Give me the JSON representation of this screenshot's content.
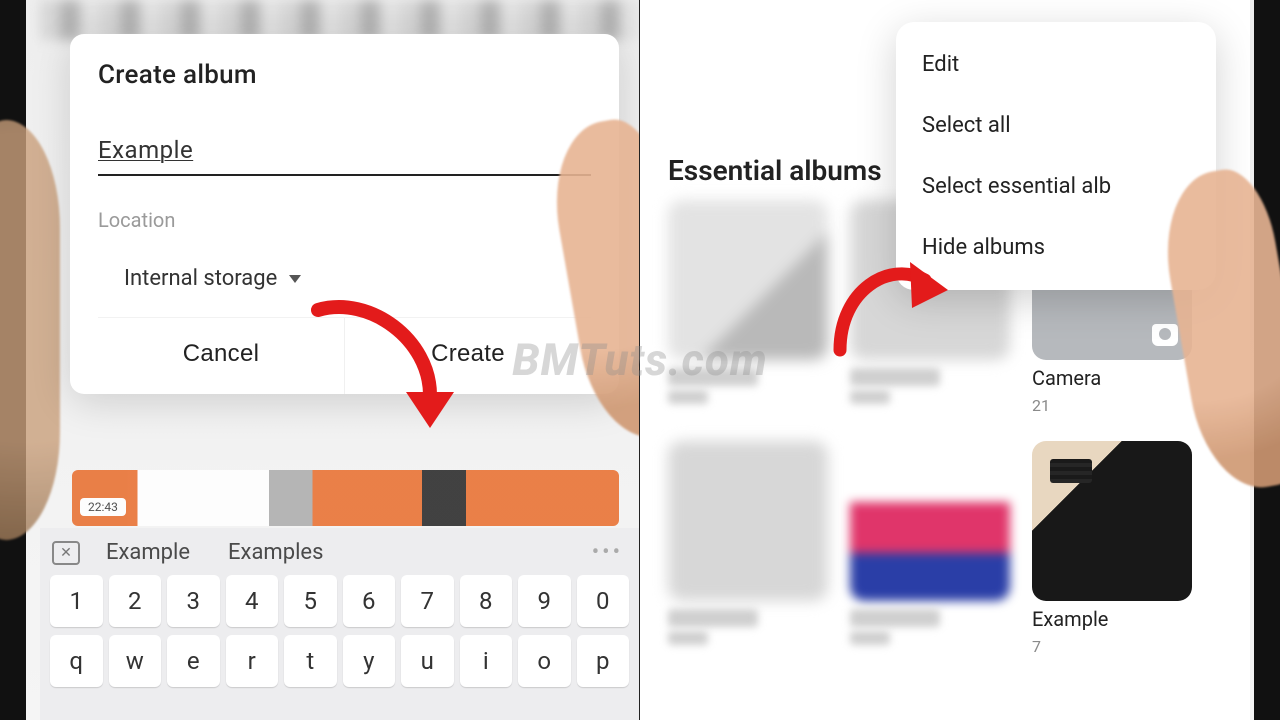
{
  "watermark": "BMTuts.com",
  "left": {
    "dialog": {
      "title": "Create album",
      "album_name": "Example",
      "location_label": "Location",
      "storage_option": "Internal storage",
      "cancel": "Cancel",
      "create": "Create"
    },
    "bgstrip_time": "22:43",
    "keyboard": {
      "suggestions": [
        "Example",
        "Examples"
      ],
      "row_numbers": [
        "1",
        "2",
        "3",
        "4",
        "5",
        "6",
        "7",
        "8",
        "9",
        "0"
      ],
      "row_letters": [
        "q",
        "w",
        "e",
        "r",
        "t",
        "y",
        "u",
        "i",
        "o",
        "p"
      ]
    }
  },
  "right": {
    "section_title": "Essential albums",
    "menu_items": [
      "Edit",
      "Select all",
      "Select essential alb",
      "Hide albums"
    ],
    "albums": [
      {
        "name": "Camera",
        "count": "21"
      },
      {
        "name": "Example",
        "count": "7"
      }
    ]
  }
}
